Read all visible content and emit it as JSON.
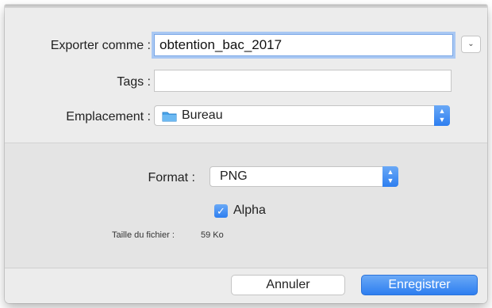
{
  "dialog": {
    "export_label": "Exporter comme :",
    "export_value": "obtention_bac_2017",
    "tags_label": "Tags :",
    "tags_value": "",
    "location_label": "Emplacement :",
    "location_value": "Bureau",
    "location_icon": "folder-icon"
  },
  "options": {
    "format_label": "Format :",
    "format_value": "PNG",
    "alpha_label": "Alpha",
    "alpha_checked": true,
    "filesize_label": "Taille du fichier :",
    "filesize_value": "59 Ko"
  },
  "buttons": {
    "cancel_label": "Annuler",
    "save_label": "Enregistrer"
  },
  "colors": {
    "accent": "#2d7ef0",
    "focus_ring": "#a9c8f3",
    "folder": "#4aa3e8"
  }
}
